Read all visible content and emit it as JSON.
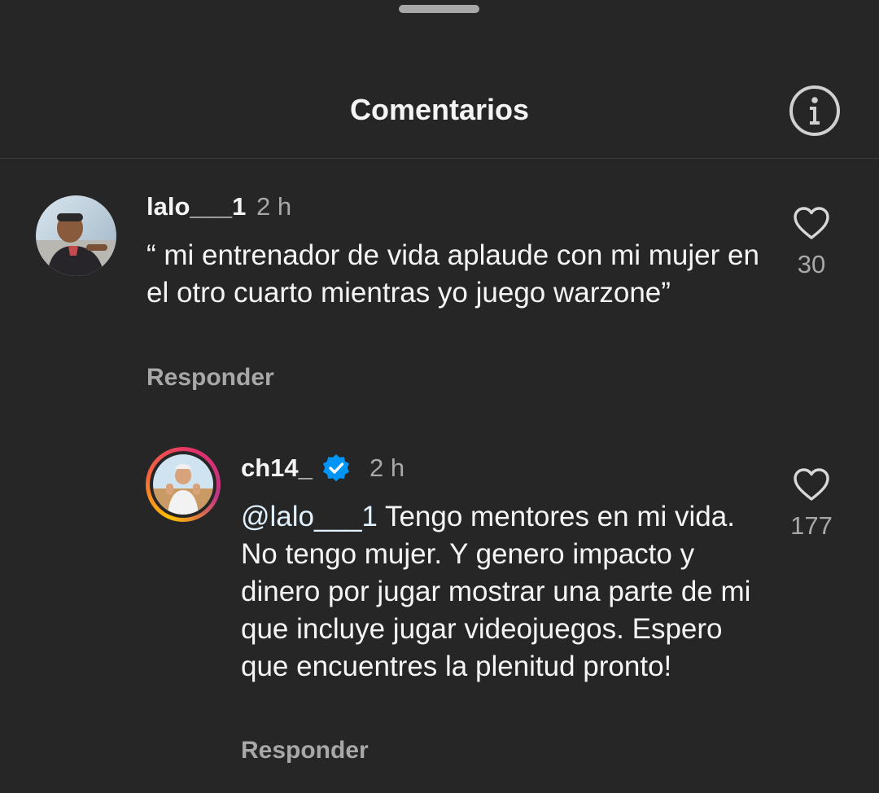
{
  "sheet": {
    "title": "Comentarios"
  },
  "comments": [
    {
      "username": "lalo___1",
      "time": "2 h",
      "text": "“ mi entrenador de vida aplaude con mi mujer en el otro cuarto mientras yo juego warzone”",
      "reply_label": "Responder",
      "likes": "30"
    },
    {
      "username": "ch14_",
      "verified": true,
      "time": "2 h",
      "mention": "@lalo___1",
      "text": " Tengo mentores en mi vida. No tengo mujer. Y genero impacto y dinero por jugar mostrar una parte de mi que incluye jugar videojuegos. Espero que encuentres la plenitud pronto!",
      "reply_label": "Responder",
      "likes": "177"
    }
  ],
  "colors": {
    "background": "#262626",
    "secondary_text": "#a8a8a8",
    "verified": "#0095f6"
  },
  "icons": [
    "info-icon",
    "heart-outline-icon",
    "verified-badge-icon"
  ]
}
